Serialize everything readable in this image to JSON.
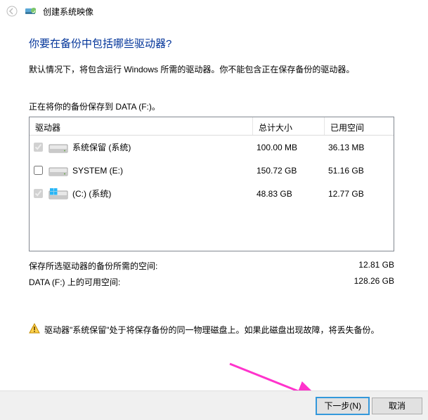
{
  "window": {
    "title": "创建系统映像"
  },
  "header": {
    "question": "你要在备份中包括哪些驱动器?",
    "description": "默认情况下，将包含运行 Windows 所需的驱动器。你不能包含正在保存备份的驱动器。"
  },
  "savingTo": "正在将你的备份保存到 DATA (F:)。",
  "table": {
    "col_drive": "驱动器",
    "col_total": "总计大小",
    "col_used": "已用空间",
    "rows": [
      {
        "checked": true,
        "disabled": true,
        "icon": "plain",
        "name": "系统保留 (系统)",
        "size": "100.00 MB",
        "used": "36.13 MB"
      },
      {
        "checked": false,
        "disabled": false,
        "icon": "plain",
        "name": "SYSTEM (E:)",
        "size": "150.72 GB",
        "used": "51.16 GB"
      },
      {
        "checked": true,
        "disabled": true,
        "icon": "win",
        "name": "(C:) (系统)",
        "size": "48.83 GB",
        "used": "12.77 GB"
      }
    ]
  },
  "summary": {
    "required_label": "保存所选驱动器的备份所需的空间:",
    "required_value": "12.81 GB",
    "available_label": "DATA (F:) 上的可用空间:",
    "available_value": "128.26 GB"
  },
  "warning": "驱动器\"系统保留\"处于将保存备份的同一物理磁盘上。如果此磁盘出现故障，将丢失备份。",
  "buttons": {
    "next": "下一步(N)",
    "cancel": "取消"
  }
}
